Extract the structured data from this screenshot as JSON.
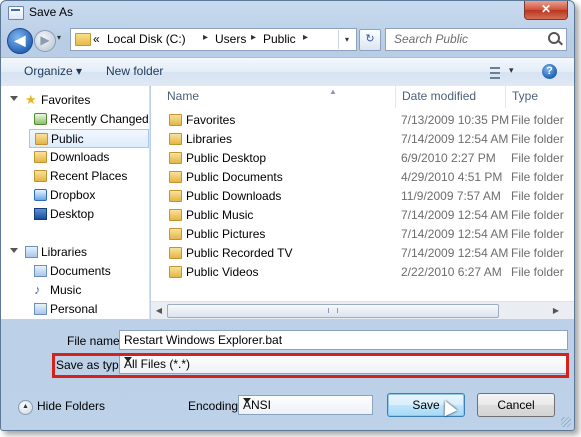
{
  "window": {
    "title": "Save As",
    "close_label": "✕"
  },
  "nav": {
    "back_glyph": "◀",
    "forward_glyph": "▶",
    "history_glyph": "▾",
    "breadcrumb_prefix": "«",
    "breadcrumbs": [
      "Local Disk (C:)",
      "Users",
      "Public"
    ],
    "separator": "▸",
    "refresh_glyph": "↻",
    "search_placeholder": "Search Public"
  },
  "toolbar": {
    "organize_label": "Organize ▾",
    "new_folder_label": "New folder",
    "help_glyph": "?"
  },
  "sidebar": {
    "items": [
      {
        "label": "Favorites",
        "icon": "star-icon"
      },
      {
        "label": "Recently Changed",
        "icon": "recent-icon"
      },
      {
        "label": "Public",
        "icon": "folder-icon"
      },
      {
        "label": "Downloads",
        "icon": "folder-icon"
      },
      {
        "label": "Recent Places",
        "icon": "recent-places-icon"
      },
      {
        "label": "Dropbox",
        "icon": "dropbox-icon"
      },
      {
        "label": "Desktop",
        "icon": "desktop-icon"
      },
      {
        "label": "Libraries",
        "icon": "libraries-icon"
      },
      {
        "label": "Documents",
        "icon": "documents-icon"
      },
      {
        "label": "Music",
        "icon": "music-icon"
      },
      {
        "label": "Personal",
        "icon": "personal-icon"
      }
    ]
  },
  "files": {
    "columns": [
      "Name",
      "Date modified",
      "Type"
    ],
    "rows": [
      {
        "name": "Favorites",
        "date": "7/13/2009 10:35 PM",
        "type": "File folder"
      },
      {
        "name": "Libraries",
        "date": "7/14/2009 12:54 AM",
        "type": "File folder"
      },
      {
        "name": "Public Desktop",
        "date": "6/9/2010 2:27 PM",
        "type": "File folder"
      },
      {
        "name": "Public Documents",
        "date": "4/29/2010 4:51 PM",
        "type": "File folder"
      },
      {
        "name": "Public Downloads",
        "date": "11/9/2009 7:57 AM",
        "type": "File folder"
      },
      {
        "name": "Public Music",
        "date": "7/14/2009 12:54 AM",
        "type": "File folder"
      },
      {
        "name": "Public Pictures",
        "date": "7/14/2009 12:54 AM",
        "type": "File folder"
      },
      {
        "name": "Public Recorded TV",
        "date": "7/14/2009 12:54 AM",
        "type": "File folder"
      },
      {
        "name": "Public Videos",
        "date": "2/22/2010 6:27 AM",
        "type": "File folder"
      }
    ]
  },
  "form": {
    "file_name_label": "File name:",
    "file_name_value": "Restart Windows Explorer.bat",
    "save_type_label": "Save as type:",
    "save_type_value": "All Files  (*.*)",
    "hide_folders_label": "Hide Folders",
    "encoding_label": "Encoding:",
    "encoding_value": "ANSI",
    "save_label": "Save",
    "cancel_label": "Cancel"
  },
  "colors": {
    "highlight": "#d4221d",
    "accent": "#3c7fb1"
  }
}
